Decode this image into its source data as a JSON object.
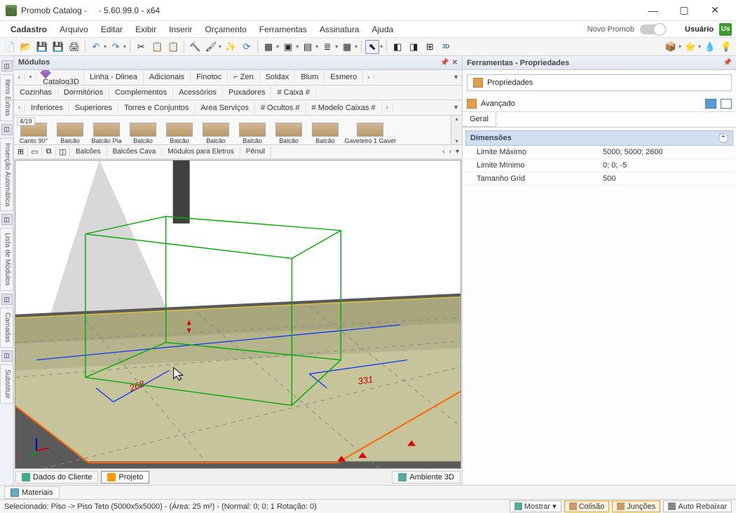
{
  "window": {
    "app": "Promob Catalog -",
    "version": "- 5.60.99.0 - x64",
    "novo_label": "Novo Promob",
    "user_label": "Usuário",
    "user_badge": "Us"
  },
  "menu": [
    "Cadastro",
    "Arquivo",
    "Editar",
    "Exibir",
    "Inserir",
    "Orçamento",
    "Ferramentas",
    "Assinatura",
    "Ajuda"
  ],
  "left_tabs": [
    "Itens Extras",
    "Inserção Automática",
    "Lista de Módulos",
    "Camadas",
    "Substituir"
  ],
  "modules": {
    "title": "Módulos",
    "row1": [
      "Catalog3D",
      "Linha - Dlinea",
      "Adicionais",
      "Finotoc",
      "Zen",
      "Soldax",
      "Blum",
      "Esmero"
    ],
    "row2": [
      "Cozinhas",
      "Dormitórios",
      "Complementos",
      "Acessórios",
      "Puxadores",
      "# Caixa #"
    ],
    "row3": [
      "Inferiores",
      "Superiores",
      "Torres e Conjuntos",
      "Area Serviços",
      "# Ocultos #",
      "# Modelo Caixas #"
    ],
    "counter": "4/19",
    "items": [
      "Canto 90°",
      "Balcão",
      "Balcão Pia",
      "Balcão",
      "Balcão",
      "Balcão",
      "Balcão",
      "Balcão",
      "Balcão",
      "Gaveteiro 1 Gavet"
    ],
    "row4": [
      "Balcões",
      "Balcões Cava",
      "Módulos para Eletros",
      "Pênsil"
    ]
  },
  "bottom_tabs": {
    "dados": "Dados do Cliente",
    "projeto": "Projeto",
    "ambiente": "Ambiente 3D",
    "materiais": "Materiais"
  },
  "props": {
    "title": "Ferramentas - Propriedades",
    "btn": "Propriedades",
    "advanced": "Avançado",
    "tab": "Geral",
    "section": "Dimensões",
    "rows": [
      {
        "k": "Limite Máximo",
        "v": "5000; 5000; 2600"
      },
      {
        "k": "Limite Mínimo",
        "v": "0; 0; -5"
      },
      {
        "k": "Tamanho Grid",
        "v": "500"
      }
    ]
  },
  "status": {
    "text": "Selecionado: Piso -> Piso Teto (5000x5x5000) - (Área: 25 m²) - (Normal: 0; 0; 1 Rotação: 0)",
    "mostrar": "Mostrar",
    "colisao": "Colisão",
    "juncoes": "Junções",
    "auto": "Auto Rebaixar"
  },
  "viewport": {
    "dim1": "268",
    "dim2": "331"
  }
}
